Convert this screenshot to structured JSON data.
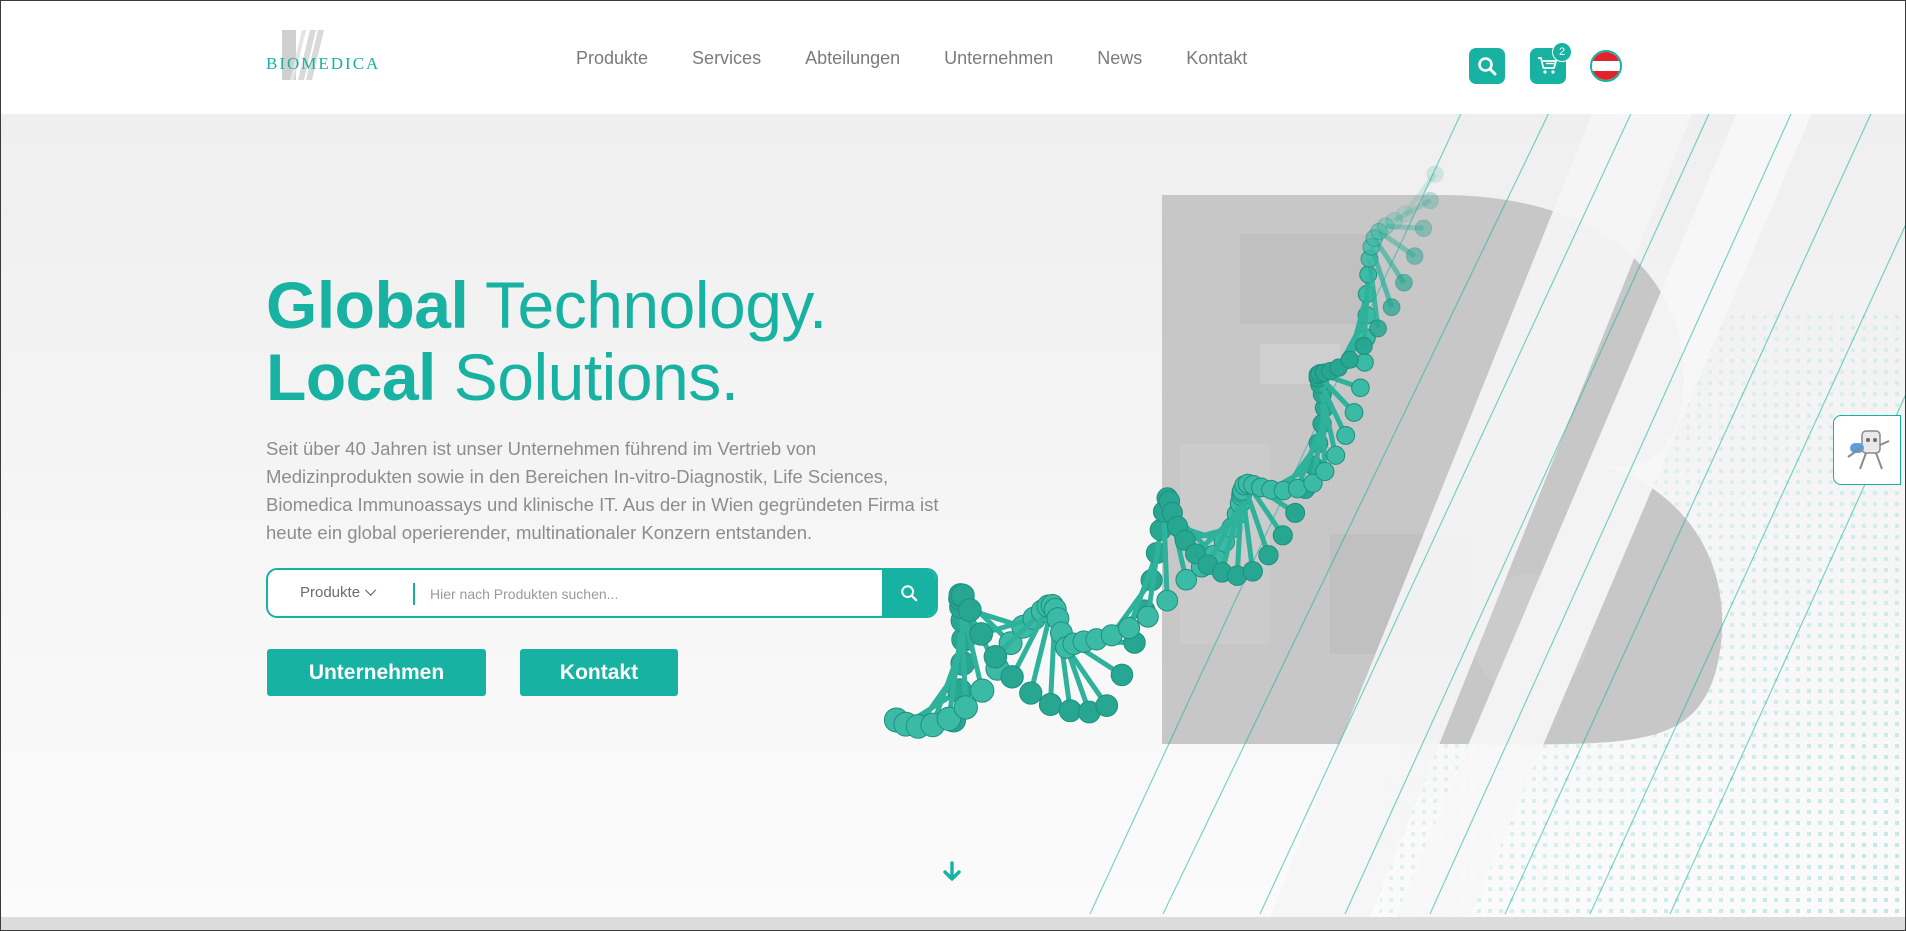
{
  "brand": {
    "name": "BIOMEDICA",
    "color": "#17b2a1"
  },
  "nav": {
    "items": [
      {
        "label": "Produkte"
      },
      {
        "label": "Services"
      },
      {
        "label": "Abteilungen"
      },
      {
        "label": "Unternehmen"
      },
      {
        "label": "News"
      },
      {
        "label": "Kontakt"
      }
    ]
  },
  "header_actions": {
    "search_icon": "search-icon",
    "cart_icon": "cart-icon",
    "cart_count": "2",
    "language_flag": "austria-flag"
  },
  "hero": {
    "title_line1_bold": "Global",
    "title_line1_rest": " Technology.",
    "title_line2_bold": "Local",
    "title_line2_rest": " Solutions.",
    "description": "Seit über 40 Jahren ist unser Unternehmen führend im Vertrieb von Medizinprodukten sowie in den Bereichen In-vitro-Diagnostik, Life Sciences, Biomedica Immunoassays und klinische IT. Aus der in Wien gegründeten Firma ist heute ein global operierender, multinationaler Konzern entstanden."
  },
  "search": {
    "category": "Produkte",
    "placeholder": "Hier nach Produkten suchen...",
    "value": ""
  },
  "cta": {
    "primary": "Unternehmen",
    "secondary": "Kontakt"
  },
  "colors": {
    "accent": "#17b2a1",
    "text_muted": "#8d8d8d",
    "flag_red": "#e0232c"
  }
}
